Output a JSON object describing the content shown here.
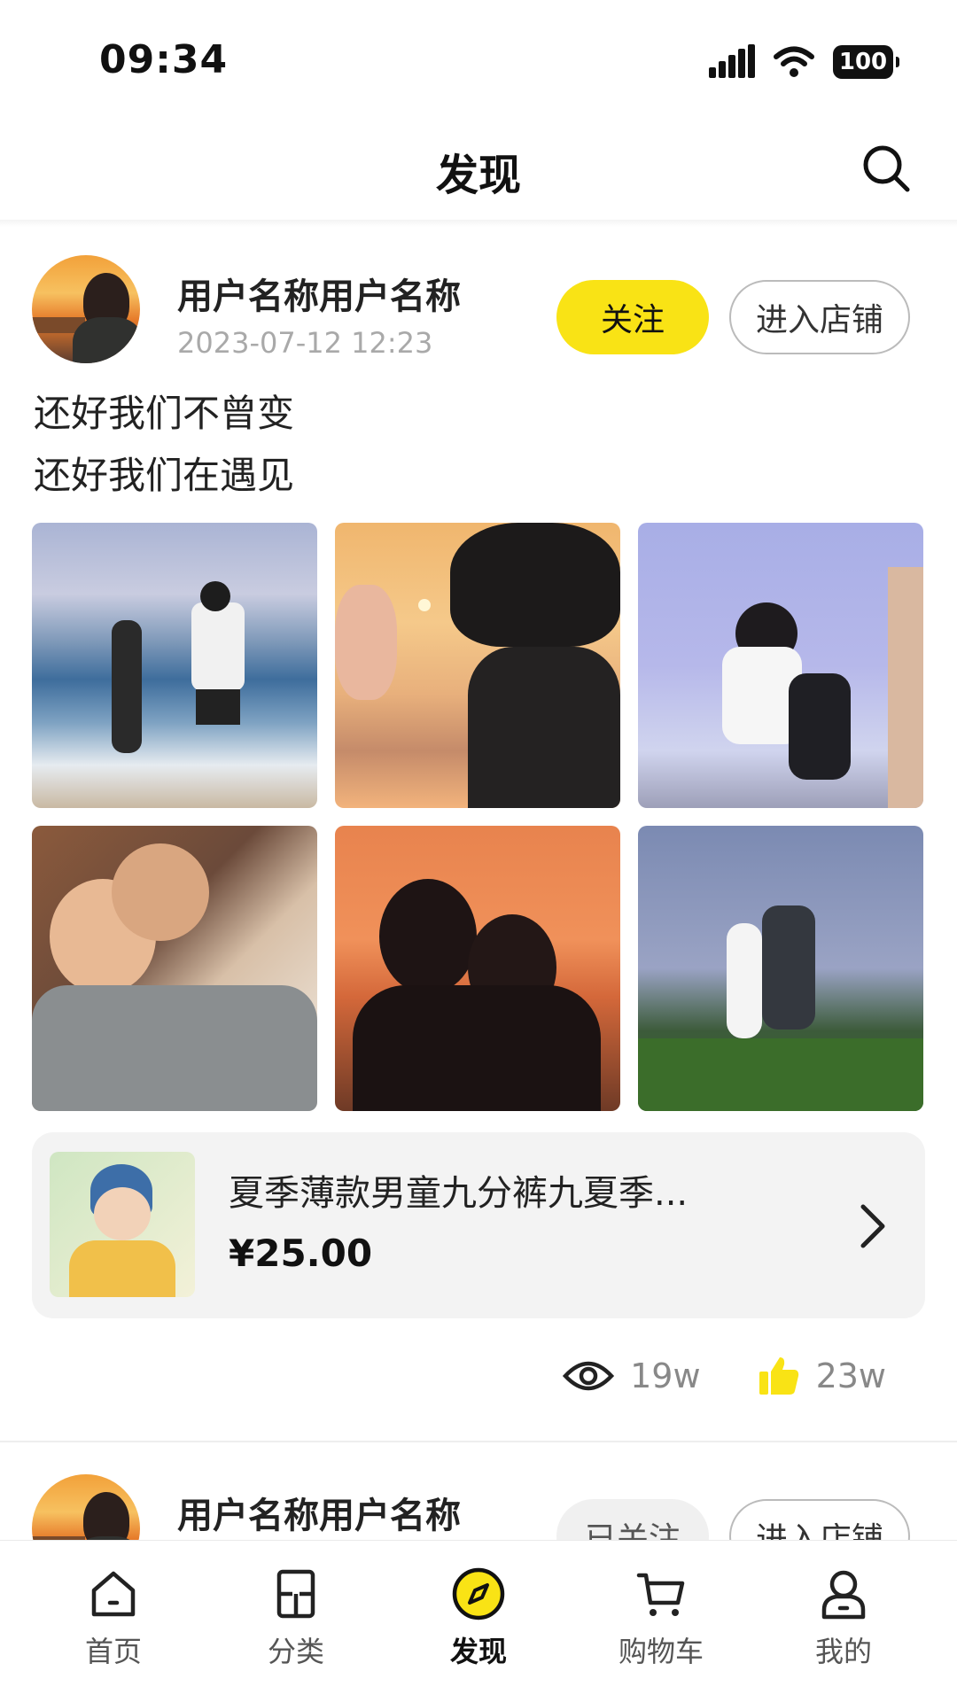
{
  "status_bar": {
    "time": "09:34",
    "battery": "100"
  },
  "header": {
    "title": "发现"
  },
  "posts": [
    {
      "username": "用户名称用户名称",
      "time": "2023-07-12 12:23",
      "follow_label": "关注",
      "shop_label": "进入店铺",
      "text_lines": [
        "还好我们不曾变",
        "还好我们在遇见"
      ],
      "product": {
        "title": "夏季薄款男童九分裤九夏季...",
        "price": "¥25.00"
      },
      "views": "19w",
      "likes": "23w"
    },
    {
      "username": "用户名称用户名称",
      "follow_label": "已关注",
      "shop_label": "进入店铺"
    }
  ],
  "tabs": [
    {
      "label": "首页",
      "icon": "home-icon"
    },
    {
      "label": "分类",
      "icon": "category-icon"
    },
    {
      "label": "发现",
      "icon": "compass-icon",
      "active": true
    },
    {
      "label": "购物车",
      "icon": "cart-icon"
    },
    {
      "label": "我的",
      "icon": "user-icon"
    }
  ],
  "colors": {
    "accent": "#f9e315",
    "like": "#f9e315"
  }
}
